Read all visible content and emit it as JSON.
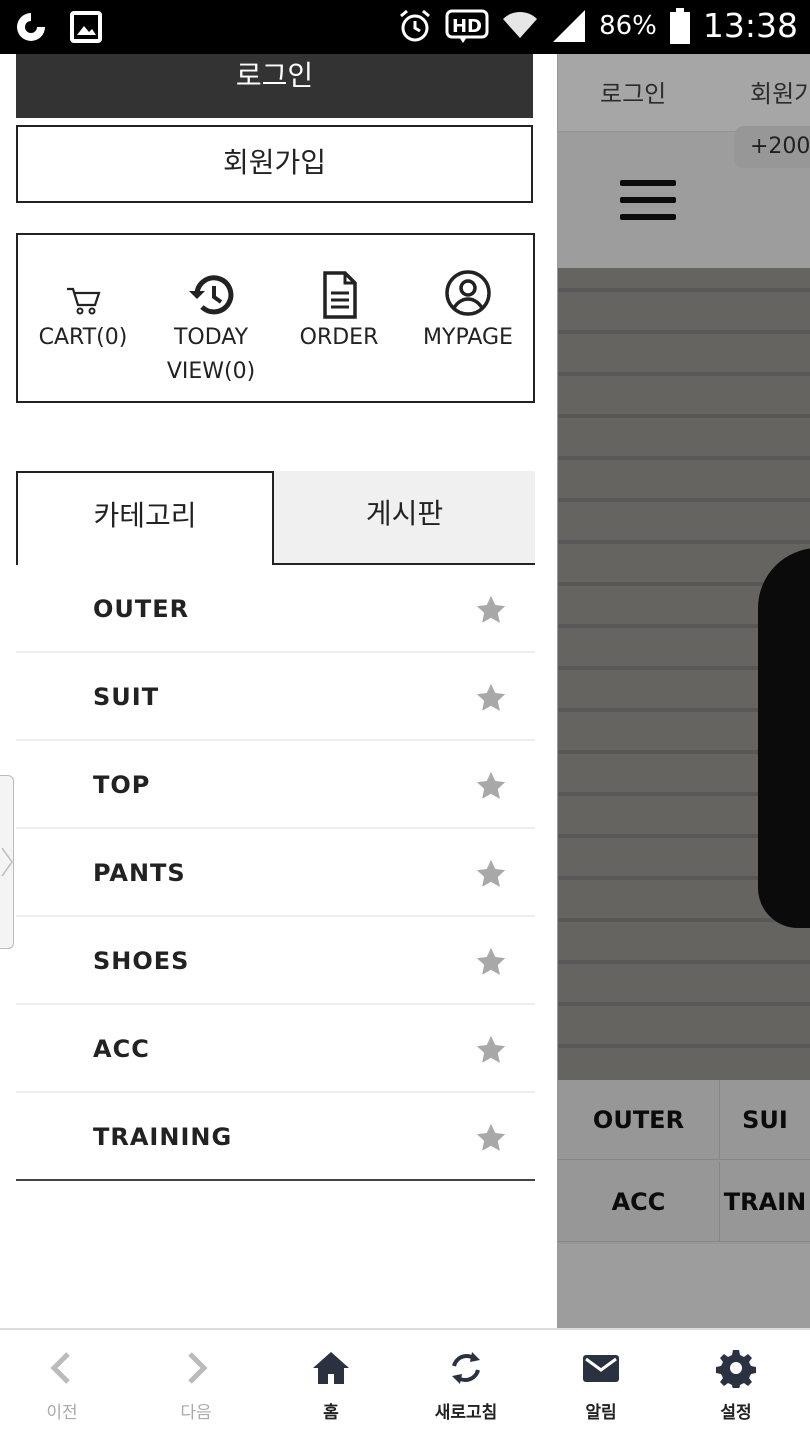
{
  "status_bar": {
    "battery": "86%",
    "time": "13:38"
  },
  "background_page": {
    "nav": [
      "로그인",
      "회원가"
    ],
    "badge": "+200",
    "categories": [
      "OUTER",
      "SUI",
      "ACC",
      "TRAIN"
    ]
  },
  "drawer": {
    "login_label": "로그인",
    "signup_label": "회원가입",
    "quick_links": [
      {
        "icon": "cart-icon",
        "line1": "CART(0)",
        "line2": ""
      },
      {
        "icon": "history-icon",
        "line1": "TODAY",
        "line2": "VIEW(0)"
      },
      {
        "icon": "document-icon",
        "line1": "ORDER",
        "line2": ""
      },
      {
        "icon": "user-circle-icon",
        "line1": "MYPAGE",
        "line2": ""
      }
    ],
    "tabs": [
      "카테고리",
      "게시판"
    ],
    "categories": [
      "OUTER",
      "SUIT",
      "TOP",
      "PANTS",
      "SHOES",
      "ACC",
      "TRAINING"
    ]
  },
  "bottom_nav": [
    {
      "label": "이전",
      "icon": "chevron-left-icon",
      "disabled": true
    },
    {
      "label": "다음",
      "icon": "chevron-right-icon",
      "disabled": true
    },
    {
      "label": "홈",
      "icon": "home-icon",
      "disabled": false
    },
    {
      "label": "새로고침",
      "icon": "refresh-icon",
      "disabled": false
    },
    {
      "label": "알림",
      "icon": "mail-icon",
      "disabled": false
    },
    {
      "label": "설정",
      "icon": "gear-icon",
      "disabled": false
    }
  ],
  "colors": {
    "login_bg": "#333333",
    "tab_inactive_bg": "#f0f0f0",
    "star": "#a8a8a8"
  }
}
